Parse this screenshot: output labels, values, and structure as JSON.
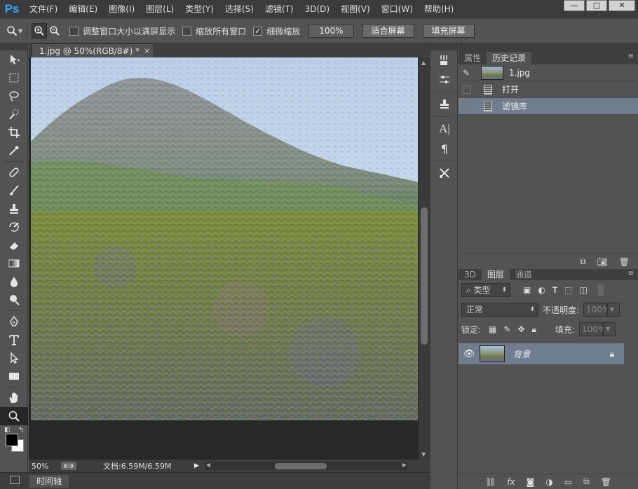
{
  "app": {
    "logo": "Ps"
  },
  "menu": [
    "文件(F)",
    "编辑(E)",
    "图像(I)",
    "图层(L)",
    "类型(Y)",
    "选择(S)",
    "滤镜(T)",
    "3D(D)",
    "视图(V)",
    "窗口(W)",
    "帮助(H)"
  ],
  "window_controls": {
    "minimize": "—",
    "maximize": "□",
    "close": "✕"
  },
  "options": {
    "resize_windows": {
      "label": "调整窗口大小以满屏显示",
      "checked": false
    },
    "zoom_all": {
      "label": "缩放所有窗口",
      "checked": false
    },
    "scrubby_zoom": {
      "label": "细微缩放",
      "checked": true
    },
    "btn_100": "100%",
    "btn_fit": "适合屏幕",
    "btn_fill": "填充屏幕"
  },
  "document": {
    "tab_title": "1.jpg @ 50%(RGB/8#) *",
    "tab_close": "×"
  },
  "status": {
    "zoom": "50%",
    "doc_info": "文档:6.59M/6.59M"
  },
  "timeline": {
    "tab": "时间轴"
  },
  "panels": {
    "top_tabs": [
      "属性",
      "历史记录"
    ],
    "history_snapshot": "1.jpg",
    "history_items": [
      "打开",
      "滤镜库"
    ],
    "layers_tabs": [
      "3D",
      "图层",
      "通道"
    ],
    "filter_kind": "类型",
    "blend_mode": "正常",
    "opacity_label": "不透明度:",
    "opacity_value": "100%",
    "lock_label": "锁定:",
    "fill_label": "填充:",
    "fill_value": "100%",
    "layer_name": "背景"
  },
  "colors": {
    "accent_logo": "#31a8ff",
    "selection": "#6f7d8f",
    "foreground": "#000000",
    "background": "#ffffff"
  }
}
